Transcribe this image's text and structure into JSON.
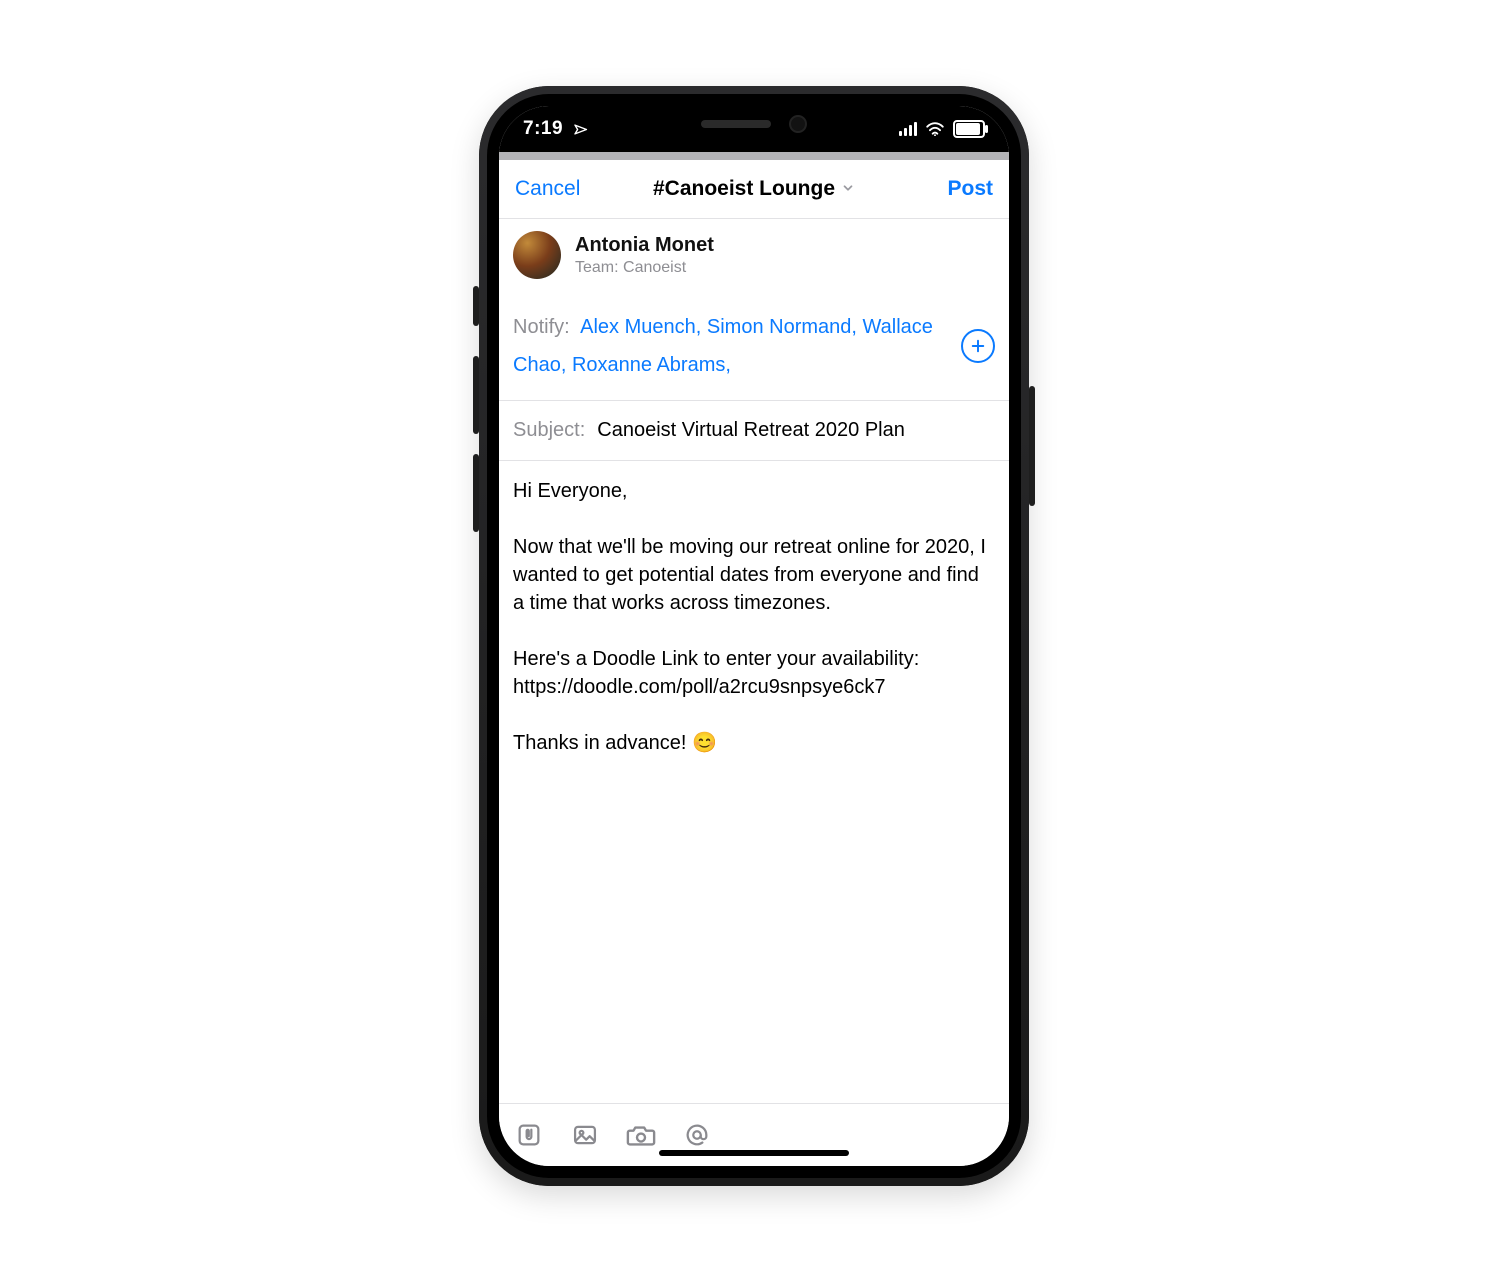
{
  "statusbar": {
    "time": "7:19"
  },
  "navbar": {
    "cancel_label": "Cancel",
    "title": "#Canoeist Lounge",
    "post_label": "Post"
  },
  "author": {
    "name": "Antonia Monet",
    "team_label": "Team: Canoeist"
  },
  "notify": {
    "label": "Notify:",
    "recipients": [
      "Alex Muench",
      "Simon Normand",
      "Wallace Chao",
      "Roxanne Abrams"
    ]
  },
  "subject": {
    "label": "Subject:",
    "value": "Canoeist Virtual Retreat 2020 Plan"
  },
  "body": "Hi Everyone,\n\nNow that we'll be moving our retreat online for 2020, I wanted to get potential dates from everyone and find a time that works across timezones.\n\nHere's a Doodle Link to enter your availability: https://doodle.com/poll/a2rcu9snpsye6ck7\n\nThanks in advance! 😊",
  "toolbar_icons": {
    "attach": "paperclip-icon",
    "image": "image-icon",
    "camera": "camera-icon",
    "mention": "at-icon"
  }
}
